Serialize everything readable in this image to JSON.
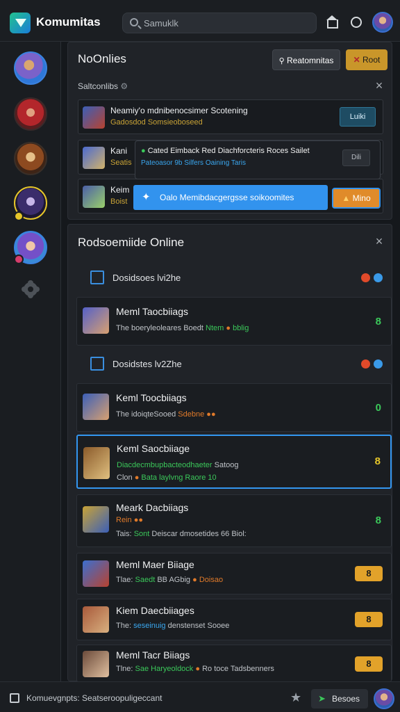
{
  "app": {
    "title": "Komumitas"
  },
  "search": {
    "placeholder": "Samuklk"
  },
  "top_panel": {
    "title": "NoOnlies",
    "btn_secondary": "Reatomnitas",
    "btn_primary": "Root",
    "subheader": "Saltconlibs",
    "cards": [
      {
        "name": "Neamiy'o mdnibenocsimer Scotening",
        "sub": "Gadosdod Somsieoboseed",
        "button": "Luiki"
      },
      {
        "name": "Kani",
        "sub": "Seatis"
      },
      {
        "name": "Keim",
        "sub": "Boist"
      }
    ],
    "popover": {
      "line1": "Cated Eimback Red Diachforcteris Roces Sailet",
      "line2": "Pateoasor 9b Silfers Oaining Taris",
      "button": "Dili"
    },
    "banner": {
      "text": "Oalo Memibdacgergsse soikoomites",
      "button": "Mino"
    }
  },
  "bottom_panel": {
    "title": "Rodsoemiide Online",
    "sections": [
      {
        "label": "Dosidsoes lvi2he",
        "dots": [
          "#e04a2a",
          "#3a9ae8"
        ]
      },
      {
        "label": "Dosidstes lv2Zhe",
        "dots": [
          "#e04a2a",
          "#3a9ae8"
        ]
      }
    ],
    "rows": [
      {
        "name": "Meml Taocbiiags",
        "sub_a": "The boeryleoleares Boedt",
        "sub_b": "Ntem",
        "sub_c": "bblig",
        "count": "8"
      },
      {
        "name": "Keml Toocbiiags",
        "sub_a": "The idoiqteSooed",
        "sub_b": "Sdebne",
        "count": "0"
      },
      {
        "name": "Keml Saocbiiage",
        "sub_a": "Diacdecmbupbacteodhaeter",
        "sub_b": "Satoog",
        "sub_c": "Clon",
        "sub_d": "Bata laylvng Raore 10",
        "count": "8"
      },
      {
        "name": "Meark Dacbiiags",
        "sub_a": "Rein",
        "sub_b": "Tais:",
        "sub_c": "Sont",
        "sub_d": "Deiscar dmosetides 66 Biol:",
        "count": "8"
      },
      {
        "name": "Meml Maer Biiage",
        "sub_a": "Tlae:",
        "sub_b": "Saedt",
        "sub_c": "BB AGbig",
        "sub_d": "Doisao",
        "badge": "8"
      },
      {
        "name": "Kiem Daecbiiages",
        "sub_a": "The:",
        "sub_b": "seseinuig",
        "sub_c": "denstenset Sooee",
        "badge": "8"
      },
      {
        "name": "Meml Tacr Biiags",
        "sub_a": "Tlne:",
        "sub_b": "Sae Haryeoldock",
        "sub_c": "Ro",
        "sub_d": "toce Tadsbenners",
        "badge": "8"
      }
    ]
  },
  "bottom_bar": {
    "status": "Komuevgnpts: Seatseroopuligeccant",
    "button": "Besoes"
  }
}
